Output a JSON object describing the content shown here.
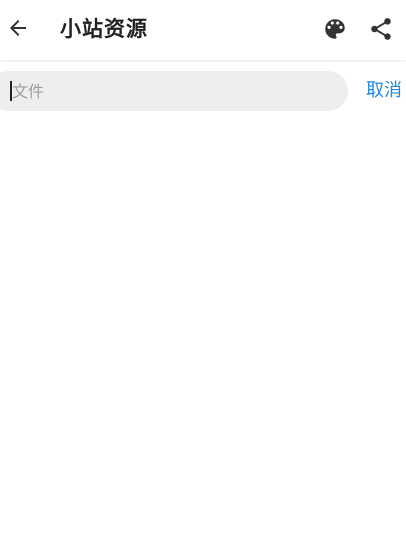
{
  "header": {
    "title": "小站资源",
    "icons": {
      "back": "arrow-left-icon",
      "palette": "palette-icon",
      "share": "share-icon"
    }
  },
  "search": {
    "value": "",
    "placeholder": "文件",
    "cancel_label": "取消"
  },
  "colors": {
    "accent": "#1e88e5",
    "title_text": "#222222",
    "search_background": "#eeeeee",
    "placeholder_text": "#9e9e9e"
  }
}
